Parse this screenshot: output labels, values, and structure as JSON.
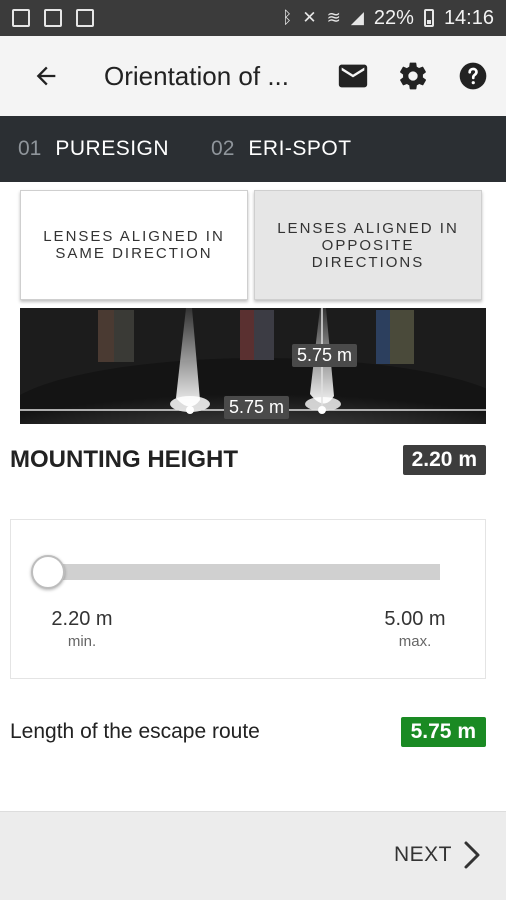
{
  "status": {
    "battery": "22%",
    "time": "14:16"
  },
  "appbar": {
    "title": "Orientation of ..."
  },
  "steps": [
    {
      "num": "01",
      "label": "PURESIGN"
    },
    {
      "num": "02",
      "label": "ERI-SPOT"
    }
  ],
  "toggle": {
    "same": "LENSES ALIGNED IN SAME DIRECTION",
    "opposite": "LENSES ALIGNED IN OPPOSITE DIRECTIONS"
  },
  "preview": {
    "vertical_distance": "5.75 m",
    "horizontal_distance": "5.75 m"
  },
  "mounting_height": {
    "title": "MOUNTING HEIGHT",
    "value": "2.20 m"
  },
  "slider": {
    "min_value": "2.20 m",
    "min_caption": "min.",
    "max_value": "5.00 m",
    "max_caption": "max.",
    "fraction": 0.0
  },
  "escape": {
    "label": "Length of the escape route",
    "value": "5.75 m"
  },
  "footer": {
    "next_label": "NEXT"
  },
  "colors": {
    "accent_green": "#1a8a23",
    "stepbar": "#2b2f33",
    "value_badge": "#3d3d3d"
  }
}
